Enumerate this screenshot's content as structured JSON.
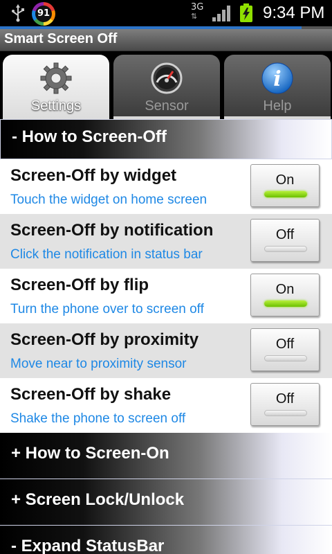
{
  "status_bar": {
    "battery_percent": "91",
    "network": "3G",
    "time": "9:34 PM",
    "icons": [
      "usb-icon",
      "battery-ring-icon",
      "network-3g-icon",
      "signal-icon",
      "battery-charging-icon"
    ]
  },
  "app": {
    "title": "Smart Screen Off"
  },
  "tabs": [
    {
      "label": "Settings",
      "icon": "gear-icon",
      "active": true
    },
    {
      "label": "Sensor",
      "icon": "gauge-icon",
      "active": false
    },
    {
      "label": "Help",
      "icon": "info-icon",
      "active": false
    }
  ],
  "group_screen_off": {
    "title": "- How to Screen-Off",
    "items": [
      {
        "title": "Screen-Off by widget",
        "subtitle": "Touch the widget on home screen",
        "state": "On"
      },
      {
        "title": "Screen-Off by notification",
        "subtitle": "Click the notification in status bar",
        "state": "Off"
      },
      {
        "title": "Screen-Off by flip",
        "subtitle": "Turn the phone over to screen off",
        "state": "On"
      },
      {
        "title": "Screen-Off by proximity",
        "subtitle": "Move near to proximity sensor",
        "state": "Off"
      },
      {
        "title": "Screen-Off by shake",
        "subtitle": "Shake the phone to screen off",
        "state": "Off"
      }
    ]
  },
  "collapsed_groups": [
    {
      "title": "+ How to Screen-On"
    },
    {
      "title": "+ Screen Lock/Unlock"
    },
    {
      "title": "- Expand StatusBar"
    }
  ],
  "colors": {
    "accent_blue": "#1e88e5",
    "toggle_on_green": "#7fd400",
    "row_grey": "#e2e2e2"
  }
}
